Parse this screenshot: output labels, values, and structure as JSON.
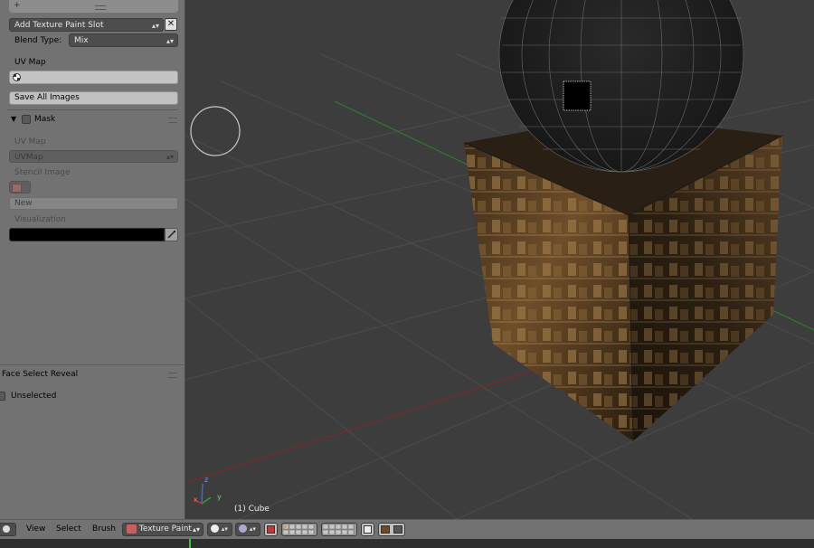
{
  "tool_panel": {
    "add_slot_label": "Add Texture Paint Slot",
    "blend_type_label": "Blend Type:",
    "blend_type_value": "Mix",
    "uv_map_label": "UV Map",
    "uv_map_value": "",
    "save_all_images_label": "Save All Images",
    "mask": {
      "title": "Mask",
      "uv_map_label": "UV Map",
      "uv_map_value": "UVMap",
      "stencil_image_label": "Stencil Image",
      "new_label": "New",
      "visualization_label": "Visualization",
      "visualization_color": "#000000"
    },
    "face_select_reveal": {
      "title": "Face Select Reveal",
      "unselected_label": "Unselected"
    }
  },
  "viewport": {
    "object_label": "(1) Cube",
    "axis_x": "x",
    "axis_y": "y",
    "axis_z": "z",
    "colors": {
      "background": "#3d3d3d",
      "grid": "#4a4a4a",
      "x_axis": "#8a2b2b",
      "y_axis": "#2f7a2f"
    }
  },
  "header": {
    "menus": [
      "View",
      "Select",
      "Brush"
    ],
    "mode_label": "Texture Paint"
  }
}
